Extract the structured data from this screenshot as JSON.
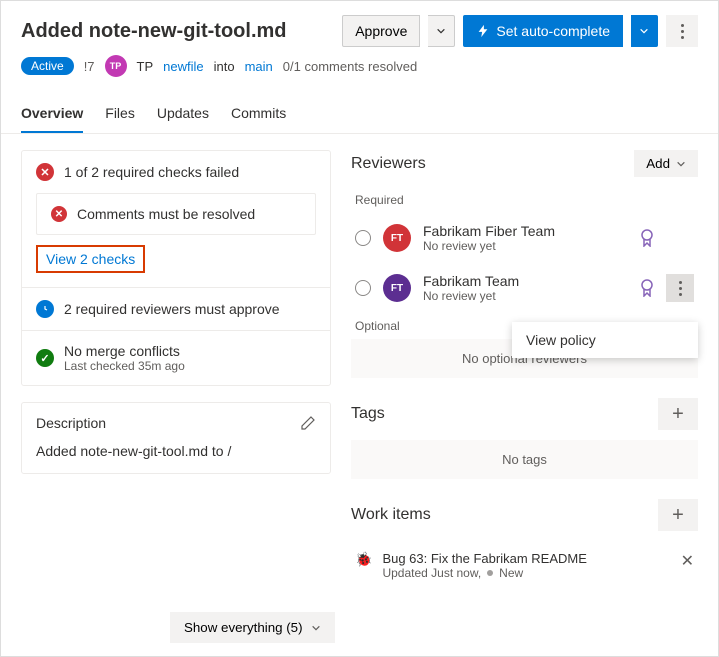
{
  "header": {
    "title": "Added note-new-git-tool.md",
    "approve": "Approve",
    "autocomplete": "Set auto-complete"
  },
  "sub": {
    "status": "Active",
    "id": "!7",
    "avatar_bg": "#c239b3",
    "avatar_text": "TP",
    "author": "TP",
    "source": "newfile",
    "into": "into",
    "target": "main",
    "comments": "0/1 comments resolved"
  },
  "tabs": [
    "Overview",
    "Files",
    "Updates",
    "Commits"
  ],
  "checks": {
    "failed": "1 of 2 required checks failed",
    "comments": "Comments must be resolved",
    "view": "View 2 checks",
    "reviewers": "2 required reviewers must approve",
    "merge": "No merge conflicts",
    "merge_sub": "Last checked 35m ago"
  },
  "desc": {
    "heading": "Description",
    "body": "Added note-new-git-tool.md to /"
  },
  "reviewers": {
    "title": "Reviewers",
    "add": "Add",
    "required": "Required",
    "optional": "Optional",
    "none": "No optional reviewers",
    "popup": "View policy",
    "items": [
      {
        "name": "Fabrikam Fiber Team",
        "status": "No review yet",
        "avatar_bg": "#d13438",
        "avatar_text": "FT"
      },
      {
        "name": "Fabrikam Team",
        "status": "No review yet",
        "avatar_bg": "#5c2e91",
        "avatar_text": "FT"
      }
    ]
  },
  "tags": {
    "title": "Tags",
    "none": "No tags"
  },
  "work": {
    "title": "Work items",
    "item": {
      "title": "Bug 63: Fix the Fabrikam README",
      "meta": "Updated Just now,",
      "state": "New"
    }
  },
  "footer": "Show everything (5)"
}
